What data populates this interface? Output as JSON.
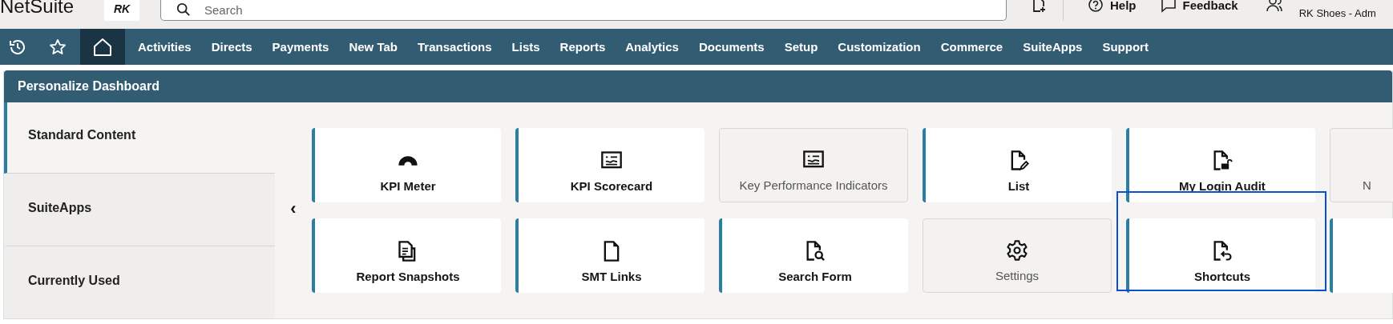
{
  "header": {
    "brand": "NetSuite",
    "logo_text": "RK",
    "search": {
      "placeholder": "Search"
    },
    "actions": [
      {
        "kind": "create"
      },
      {
        "kind": "help",
        "label": "Help"
      },
      {
        "kind": "feedback",
        "label": "Feedback"
      }
    ],
    "account": {
      "subtitle": "RK Shoes - Adm"
    }
  },
  "nav": {
    "icons": [
      {
        "kind": "recent",
        "selected": false
      },
      {
        "kind": "star",
        "selected": false
      },
      {
        "kind": "home",
        "selected": true
      }
    ],
    "items": [
      "Activities",
      "Directs",
      "Payments",
      "New Tab",
      "Transactions",
      "Lists",
      "Reports",
      "Analytics",
      "Documents",
      "Setup",
      "Customization",
      "Commerce",
      "SuiteApps",
      "Support"
    ]
  },
  "panel": {
    "title": "Personalize Dashboard",
    "prev_label": "‹",
    "sections": [
      {
        "label": "Standard Content",
        "selected": true
      },
      {
        "label": "SuiteApps",
        "selected": false
      },
      {
        "label": "Currently Used",
        "selected": false
      }
    ],
    "tiles": [
      {
        "label": "KPI Meter",
        "available": true,
        "highlighted": false
      },
      {
        "label": "KPI Scorecard",
        "available": true,
        "highlighted": false
      },
      {
        "label": "Key Performance Indicators",
        "available": false,
        "highlighted": false
      },
      {
        "label": "List",
        "available": true,
        "highlighted": false
      },
      {
        "label": "My Login Audit",
        "available": true,
        "highlighted": false
      },
      {
        "label": "N",
        "available": false,
        "highlighted": false
      },
      {
        "label": "Report Snapshots",
        "available": true,
        "highlighted": false
      },
      {
        "label": "SMT Links",
        "available": true,
        "highlighted": false
      },
      {
        "label": "Search Form",
        "available": true,
        "highlighted": false
      },
      {
        "label": "Settings",
        "available": false,
        "highlighted": false
      },
      {
        "label": "Shortcuts",
        "available": true,
        "highlighted": true
      },
      {
        "available": true,
        "highlighted": false
      }
    ]
  }
}
